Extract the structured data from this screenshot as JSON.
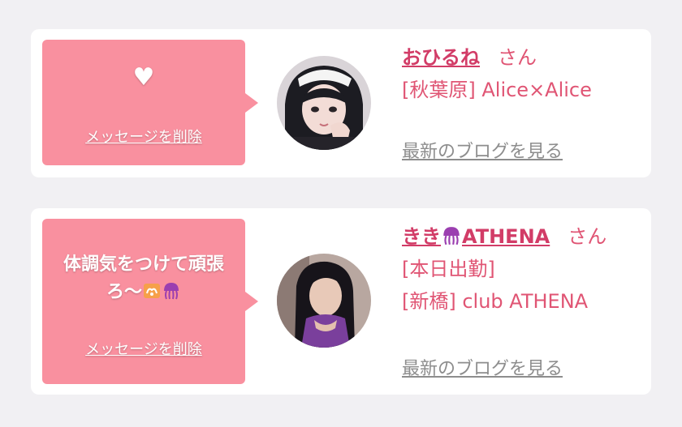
{
  "cards": [
    {
      "bubble": {
        "icon": "heart-icon",
        "delete_label": "メッセージを削除"
      },
      "name": "おひるね",
      "suffix": "さん",
      "shop": "[秋葉原] Alice×Alice",
      "blog_label": "最新のブログを見る"
    },
    {
      "bubble": {
        "message": "体調気をつけて頑張ろ〜",
        "emojis": [
          "flex-emoji-icon",
          "jellyfish-emoji-icon"
        ],
        "delete_label": "メッセージを削除"
      },
      "name_prefix": "きき",
      "name_icon": "jellyfish-emoji-icon",
      "name": "ATHENA",
      "suffix": "さん[本日出勤]",
      "shop": "[新橋] club ATHENA",
      "blog_label": "最新のブログを見る"
    }
  ],
  "colors": {
    "bubble": "#f9909f",
    "name": "#d23c67",
    "text": "#e05574",
    "link_gray": "#8d8d8d",
    "background": "#f1f0f3"
  }
}
